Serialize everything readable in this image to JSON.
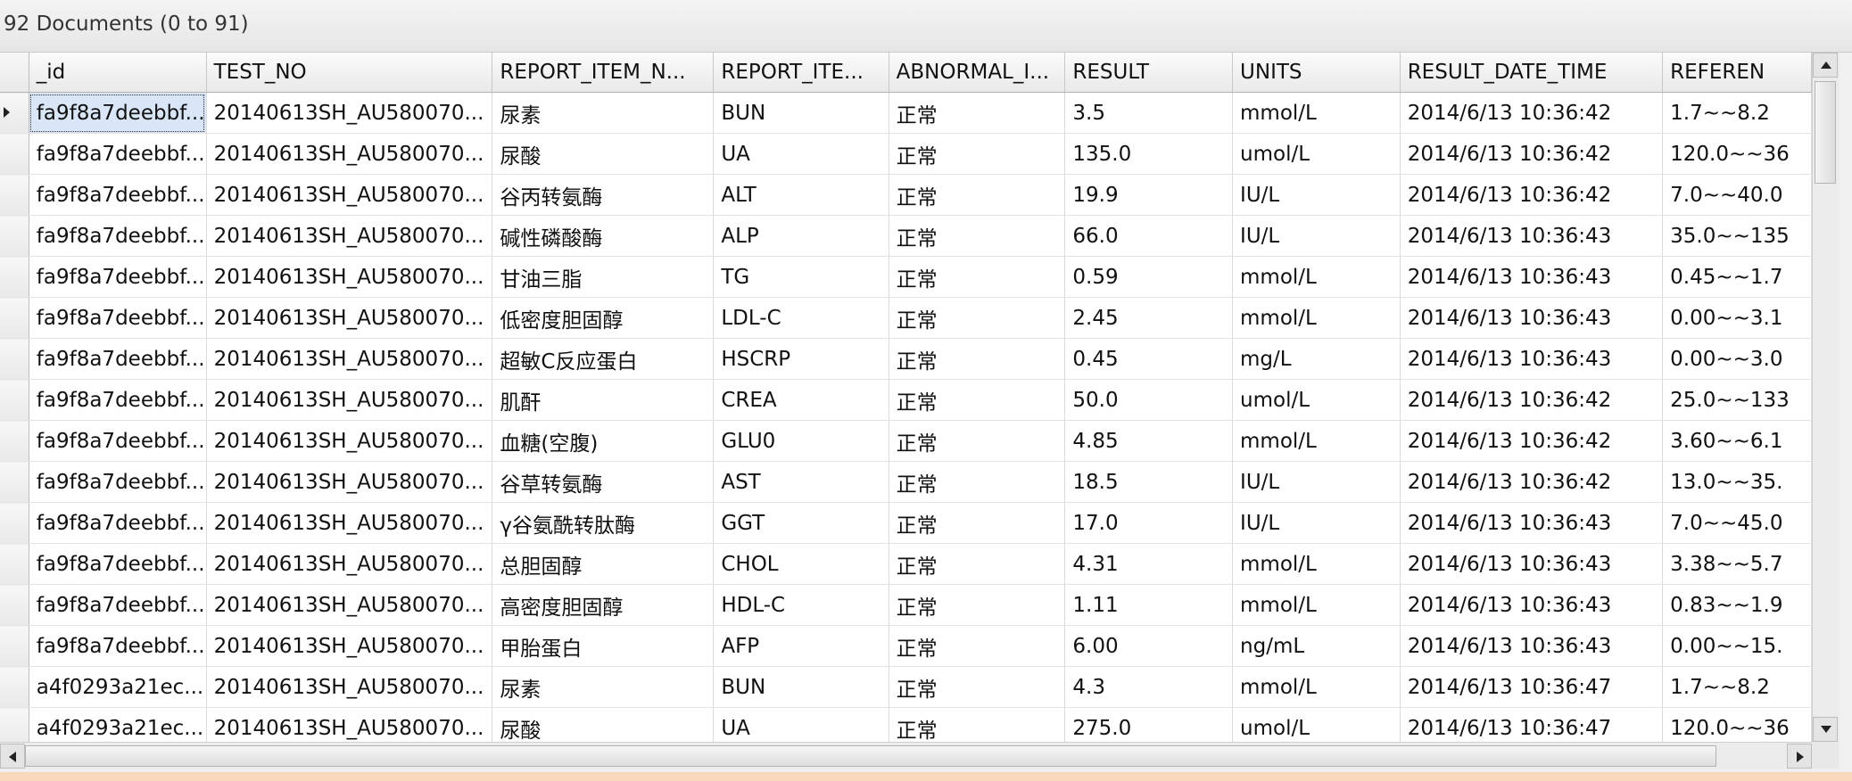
{
  "header": {
    "doc_count": "92 Documents (0 to 91)"
  },
  "columns": [
    "_id",
    "TEST_NO",
    "REPORT_ITEM_N...",
    "REPORT_ITE...",
    "ABNORMAL_I...",
    "RESULT",
    "UNITS",
    "RESULT_DATE_TIME",
    "REFEREN"
  ],
  "rows": [
    [
      "fa9f8a7deebbf...",
      "20140613SH_AU580070...",
      "尿素",
      "BUN",
      "正常",
      "3.5",
      "mmol/L",
      "2014/6/13 10:36:42",
      "1.7~~8.2"
    ],
    [
      "fa9f8a7deebbf...",
      "20140613SH_AU580070...",
      "尿酸",
      "UA",
      "正常",
      "135.0",
      "umol/L",
      "2014/6/13 10:36:42",
      "120.0~~36"
    ],
    [
      "fa9f8a7deebbf...",
      "20140613SH_AU580070...",
      "谷丙转氨酶",
      "ALT",
      "正常",
      "19.9",
      "IU/L",
      "2014/6/13 10:36:42",
      "7.0~~40.0"
    ],
    [
      "fa9f8a7deebbf...",
      "20140613SH_AU580070...",
      "碱性磷酸酶",
      "ALP",
      "正常",
      "66.0",
      "IU/L",
      "2014/6/13 10:36:43",
      "35.0~~135"
    ],
    [
      "fa9f8a7deebbf...",
      "20140613SH_AU580070...",
      "甘油三脂",
      "TG",
      "正常",
      "0.59",
      "mmol/L",
      "2014/6/13 10:36:43",
      "0.45~~1.7"
    ],
    [
      "fa9f8a7deebbf...",
      "20140613SH_AU580070...",
      "低密度胆固醇",
      "LDL-C",
      "正常",
      "2.45",
      "mmol/L",
      "2014/6/13 10:36:43",
      "0.00~~3.1"
    ],
    [
      "fa9f8a7deebbf...",
      "20140613SH_AU580070...",
      "超敏C反应蛋白",
      "HSCRP",
      "正常",
      "0.45",
      "mg/L",
      "2014/6/13 10:36:43",
      "0.00~~3.0"
    ],
    [
      "fa9f8a7deebbf...",
      "20140613SH_AU580070...",
      "肌酐",
      "CREA",
      "正常",
      "50.0",
      "umol/L",
      "2014/6/13 10:36:42",
      "25.0~~133"
    ],
    [
      "fa9f8a7deebbf...",
      "20140613SH_AU580070...",
      "血糖(空腹)",
      "GLU0",
      "正常",
      "4.85",
      "mmol/L",
      "2014/6/13 10:36:42",
      "3.60~~6.1"
    ],
    [
      "fa9f8a7deebbf...",
      "20140613SH_AU580070...",
      "谷草转氨酶",
      "AST",
      "正常",
      "18.5",
      "IU/L",
      "2014/6/13 10:36:42",
      "13.0~~35."
    ],
    [
      "fa9f8a7deebbf...",
      "20140613SH_AU580070...",
      "γ谷氨酰转肽酶",
      "GGT",
      "正常",
      "17.0",
      "IU/L",
      "2014/6/13 10:36:43",
      "7.0~~45.0"
    ],
    [
      "fa9f8a7deebbf...",
      "20140613SH_AU580070...",
      "总胆固醇",
      "CHOL",
      "正常",
      "4.31",
      "mmol/L",
      "2014/6/13 10:36:43",
      "3.38~~5.7"
    ],
    [
      "fa9f8a7deebbf...",
      "20140613SH_AU580070...",
      "高密度胆固醇",
      "HDL-C",
      "正常",
      "1.11",
      "mmol/L",
      "2014/6/13 10:36:43",
      "0.83~~1.9"
    ],
    [
      "fa9f8a7deebbf...",
      "20140613SH_AU580070...",
      "甲胎蛋白",
      "AFP",
      "正常",
      "6.00",
      "ng/mL",
      "2014/6/13 10:36:43",
      "0.00~~15."
    ],
    [
      "a4f0293a21ec...",
      "20140613SH_AU580070...",
      "尿素",
      "BUN",
      "正常",
      "4.3",
      "mmol/L",
      "2014/6/13 10:36:47",
      "1.7~~8.2"
    ],
    [
      "a4f0293a21ec...",
      "20140613SH_AU580070...",
      "尿酸",
      "UA",
      "正常",
      "275.0",
      "umol/L",
      "2014/6/13 10:36:47",
      "120.0~~36"
    ]
  ],
  "current_row": 0
}
